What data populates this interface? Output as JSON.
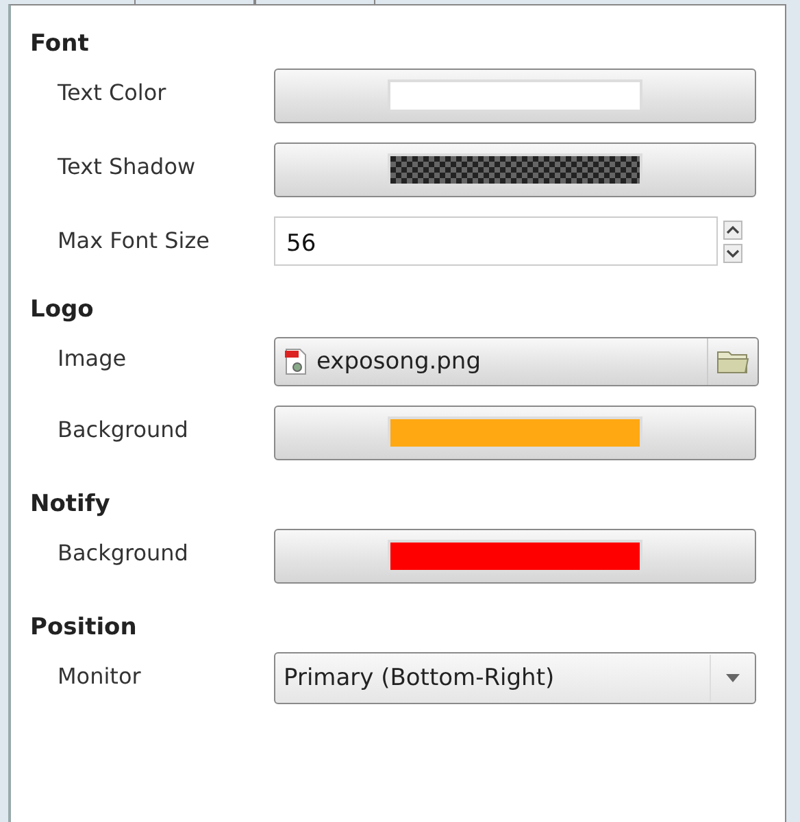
{
  "sections": [
    {
      "title": "Font",
      "rows": [
        {
          "kind": "color",
          "label": "Text Color",
          "color": "#ffffff",
          "transparent": false
        },
        {
          "kind": "color",
          "label": "Text Shadow",
          "color": "#222222",
          "transparent": true
        },
        {
          "kind": "spin",
          "label": "Max Font Size",
          "value": "56"
        }
      ]
    },
    {
      "title": "Logo",
      "rows": [
        {
          "kind": "file",
          "label": "Image",
          "value": "exposong.png"
        },
        {
          "kind": "color",
          "label": "Background",
          "color": "#ffa812",
          "transparent": false
        }
      ]
    },
    {
      "title": "Notify",
      "rows": [
        {
          "kind": "color",
          "label": "Background",
          "color": "#ff0000",
          "transparent": false
        }
      ]
    },
    {
      "title": "Position",
      "rows": [
        {
          "kind": "combo",
          "label": "Monitor",
          "value": "Primary (Bottom-Right)"
        }
      ]
    }
  ]
}
